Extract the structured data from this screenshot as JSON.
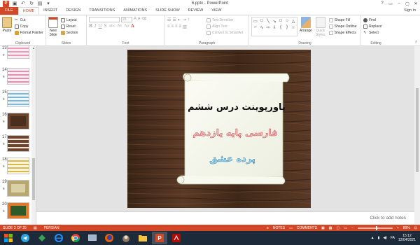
{
  "window": {
    "title": "6.pptx - PowerPoint",
    "controls": [
      "?",
      "▭",
      "–",
      "▢",
      "✕"
    ]
  },
  "tabs": [
    "FILE",
    "HOME",
    "INSERT",
    "DESIGN",
    "TRANSITIONS",
    "ANIMATIONS",
    "SLIDE SHOW",
    "REVIEW",
    "VIEW"
  ],
  "active_tab": "HOME",
  "signin": "Sign in",
  "ribbon": {
    "clipboard": {
      "label": "Clipboard",
      "paste": "Paste",
      "cut": "Cut",
      "copy": "Copy",
      "format_painter": "Format Painter"
    },
    "slides": {
      "label": "Slides",
      "new_slide_1": "New",
      "new_slide_2": "Slide",
      "layout": "Layout",
      "reset": "Reset",
      "section": "Section"
    },
    "font": {
      "label": "Font",
      "size": "28",
      "bold": "B",
      "italic": "I",
      "underline": "U",
      "strike": "S",
      "shadow": "abc",
      "spacing": "AV",
      "case": "Aa"
    },
    "paragraph": {
      "label": "Paragraph",
      "text_direction": "Text Direction",
      "align_text": "Align Text",
      "convert_smartart": "Convert to SmartArt"
    },
    "drawing": {
      "label": "Drawing",
      "arrange": "Arrange",
      "quick_styles_1": "Quick",
      "quick_styles_2": "Styles",
      "shape_fill": "Shape Fill",
      "shape_outline": "Shape Outline",
      "shape_effects": "Shape Effects"
    },
    "editing": {
      "label": "Editing",
      "find": "Find",
      "replace": "Replace",
      "select": "Select"
    }
  },
  "thumbnails": [
    {
      "num": "13"
    },
    {
      "num": "14"
    },
    {
      "num": "15"
    },
    {
      "num": "16"
    },
    {
      "num": "17"
    },
    {
      "num": "18"
    },
    {
      "num": "19"
    },
    {
      "num": "20"
    }
  ],
  "slide": {
    "line1": "پاورپوینت درس ششم",
    "line2": "فارسی پایه یازدهم",
    "line3": "پرده عشق"
  },
  "notes_placeholder": "Click to add notes",
  "status": {
    "slide_info": "SLIDE 2 OF 25",
    "language": "PERSIAN",
    "notes": "NOTES",
    "comments": "COMMENTS",
    "zoom": "89%"
  },
  "taskbar": {
    "lang": "FA",
    "time": "15:12",
    "date": "12/04/2021"
  }
}
